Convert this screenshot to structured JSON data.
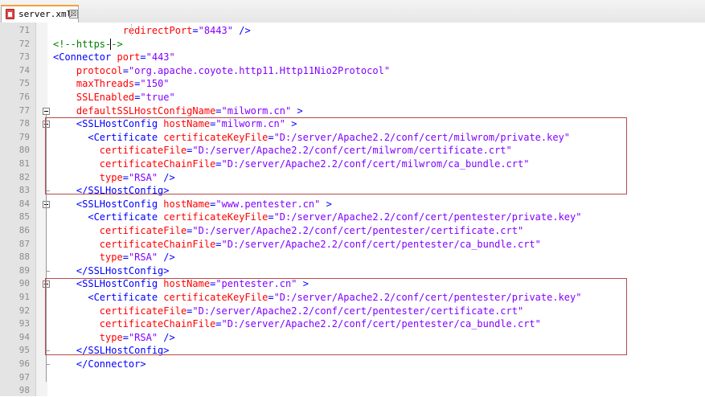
{
  "tab": {
    "filename": "server.xml",
    "close_glyph": "⊠"
  },
  "editor": {
    "lines": [
      {
        "n": "71",
        "indent": "",
        "tokens": [
          {
            "t": "ind",
            "v": "            "
          },
          {
            "t": "attr",
            "v": "redirectPort"
          },
          {
            "t": "tag",
            "v": "="
          },
          {
            "t": "val",
            "v": "\"8443\""
          },
          {
            "t": "tag",
            "v": " />"
          }
        ]
      },
      {
        "n": "72",
        "indent": "",
        "tokens": [
          {
            "t": "cmt",
            "v": "<!--https-->"
          }
        ]
      },
      {
        "n": "73",
        "indent": "",
        "tokens": [
          {
            "t": "tag",
            "v": "<Connector "
          },
          {
            "t": "attr",
            "v": "port"
          },
          {
            "t": "tag",
            "v": "="
          },
          {
            "t": "val",
            "v": "\"443\""
          }
        ]
      },
      {
        "n": "74",
        "indent": "",
        "tokens": [
          {
            "t": "ind",
            "v": "    "
          },
          {
            "t": "attr",
            "v": "protocol"
          },
          {
            "t": "tag",
            "v": "="
          },
          {
            "t": "val",
            "v": "\"org.apache.coyote.http11.Http11Nio2Protocol\""
          }
        ]
      },
      {
        "n": "75",
        "indent": "",
        "tokens": [
          {
            "t": "ind",
            "v": "    "
          },
          {
            "t": "attr",
            "v": "maxThreads"
          },
          {
            "t": "tag",
            "v": "="
          },
          {
            "t": "val",
            "v": "\"150\""
          }
        ]
      },
      {
        "n": "76",
        "indent": "",
        "tokens": [
          {
            "t": "ind",
            "v": "    "
          },
          {
            "t": "attr",
            "v": "SSLEnabled"
          },
          {
            "t": "tag",
            "v": "="
          },
          {
            "t": "val",
            "v": "\"true\""
          }
        ]
      },
      {
        "n": "77",
        "indent": "",
        "tokens": [
          {
            "t": "ind",
            "v": "    "
          },
          {
            "t": "attr",
            "v": "defaultSSLHostConfigName"
          },
          {
            "t": "tag",
            "v": "="
          },
          {
            "t": "val",
            "v": "\"milworm.cn\""
          },
          {
            "t": "tag",
            "v": " >"
          }
        ]
      },
      {
        "n": "78",
        "indent": "",
        "tokens": [
          {
            "t": "ind",
            "v": "    "
          },
          {
            "t": "tag",
            "v": "<SSLHostConfig "
          },
          {
            "t": "attr",
            "v": "hostName"
          },
          {
            "t": "tag",
            "v": "="
          },
          {
            "t": "val",
            "v": "\"milworm.cn\""
          },
          {
            "t": "tag",
            "v": " >"
          }
        ]
      },
      {
        "n": "79",
        "indent": "",
        "tokens": [
          {
            "t": "ind",
            "v": "      "
          },
          {
            "t": "tag",
            "v": "<Certificate "
          },
          {
            "t": "attr",
            "v": "certificateKeyFile"
          },
          {
            "t": "tag",
            "v": "="
          },
          {
            "t": "val",
            "v": "\"D:/server/Apache2.2/conf/cert/milwrom/private.key\""
          }
        ]
      },
      {
        "n": "80",
        "indent": "",
        "tokens": [
          {
            "t": "ind",
            "v": "        "
          },
          {
            "t": "attr",
            "v": "certificateFile"
          },
          {
            "t": "tag",
            "v": "="
          },
          {
            "t": "val",
            "v": "\"D:/server/Apache2.2/conf/cert/milwrom/certificate.crt\""
          }
        ]
      },
      {
        "n": "81",
        "indent": "",
        "tokens": [
          {
            "t": "ind",
            "v": "        "
          },
          {
            "t": "attr",
            "v": "certificateChainFile"
          },
          {
            "t": "tag",
            "v": "="
          },
          {
            "t": "val",
            "v": "\"D:/server/Apache2.2/conf/cert/milwrom/ca_bundle.crt\""
          }
        ]
      },
      {
        "n": "82",
        "indent": "",
        "tokens": [
          {
            "t": "ind",
            "v": "        "
          },
          {
            "t": "attr",
            "v": "type"
          },
          {
            "t": "tag",
            "v": "="
          },
          {
            "t": "val",
            "v": "\"RSA\""
          },
          {
            "t": "tag",
            "v": " />"
          }
        ]
      },
      {
        "n": "83",
        "indent": "",
        "tokens": [
          {
            "t": "ind",
            "v": "    "
          },
          {
            "t": "tag",
            "v": "</SSLHostConfig>"
          }
        ]
      },
      {
        "n": "84",
        "indent": "",
        "tokens": [
          {
            "t": "ind",
            "v": "    "
          },
          {
            "t": "tag",
            "v": "<SSLHostConfig "
          },
          {
            "t": "attr",
            "v": "hostName"
          },
          {
            "t": "tag",
            "v": "="
          },
          {
            "t": "val",
            "v": "\"www.pentester.cn\""
          },
          {
            "t": "tag",
            "v": " >"
          }
        ]
      },
      {
        "n": "85",
        "indent": "",
        "tokens": [
          {
            "t": "ind",
            "v": "      "
          },
          {
            "t": "tag",
            "v": "<Certificate "
          },
          {
            "t": "attr",
            "v": "certificateKeyFile"
          },
          {
            "t": "tag",
            "v": "="
          },
          {
            "t": "val",
            "v": "\"D:/server/Apache2.2/conf/cert/pentester/private.key\""
          }
        ]
      },
      {
        "n": "86",
        "indent": "",
        "tokens": [
          {
            "t": "ind",
            "v": "        "
          },
          {
            "t": "attr",
            "v": "certificateFile"
          },
          {
            "t": "tag",
            "v": "="
          },
          {
            "t": "val",
            "v": "\"D:/server/Apache2.2/conf/cert/pentester/certificate.crt\""
          }
        ]
      },
      {
        "n": "87",
        "indent": "",
        "tokens": [
          {
            "t": "ind",
            "v": "        "
          },
          {
            "t": "attr",
            "v": "certificateChainFile"
          },
          {
            "t": "tag",
            "v": "="
          },
          {
            "t": "val",
            "v": "\"D:/server/Apache2.2/conf/cert/pentester/ca_bundle.crt\""
          }
        ]
      },
      {
        "n": "88",
        "indent": "",
        "tokens": [
          {
            "t": "ind",
            "v": "        "
          },
          {
            "t": "attr",
            "v": "type"
          },
          {
            "t": "tag",
            "v": "="
          },
          {
            "t": "val",
            "v": "\"RSA\""
          },
          {
            "t": "tag",
            "v": " />"
          }
        ]
      },
      {
        "n": "89",
        "indent": "",
        "tokens": [
          {
            "t": "ind",
            "v": "    "
          },
          {
            "t": "tag",
            "v": "</SSLHostConfig>"
          }
        ]
      },
      {
        "n": "90",
        "indent": "",
        "tokens": [
          {
            "t": "ind",
            "v": "    "
          },
          {
            "t": "tag",
            "v": "<SSLHostConfig "
          },
          {
            "t": "attr",
            "v": "hostName"
          },
          {
            "t": "tag",
            "v": "="
          },
          {
            "t": "val",
            "v": "\"pentester.cn\""
          },
          {
            "t": "tag",
            "v": " >"
          }
        ]
      },
      {
        "n": "91",
        "indent": "",
        "tokens": [
          {
            "t": "ind",
            "v": "      "
          },
          {
            "t": "tag",
            "v": "<Certificate "
          },
          {
            "t": "attr",
            "v": "certificateKeyFile"
          },
          {
            "t": "tag",
            "v": "="
          },
          {
            "t": "val",
            "v": "\"D:/server/Apache2.2/conf/cert/pentester/private.key\""
          }
        ]
      },
      {
        "n": "92",
        "indent": "",
        "tokens": [
          {
            "t": "ind",
            "v": "        "
          },
          {
            "t": "attr",
            "v": "certificateFile"
          },
          {
            "t": "tag",
            "v": "="
          },
          {
            "t": "val",
            "v": "\"D:/server/Apache2.2/conf/cert/pentester/certificate.crt\""
          }
        ]
      },
      {
        "n": "93",
        "indent": "",
        "tokens": [
          {
            "t": "ind",
            "v": "        "
          },
          {
            "t": "attr",
            "v": "certificateChainFile"
          },
          {
            "t": "tag",
            "v": "="
          },
          {
            "t": "val",
            "v": "\"D:/server/Apache2.2/conf/cert/pentester/ca_bundle.crt\""
          }
        ]
      },
      {
        "n": "94",
        "indent": "",
        "tokens": [
          {
            "t": "ind",
            "v": "        "
          },
          {
            "t": "attr",
            "v": "type"
          },
          {
            "t": "tag",
            "v": "="
          },
          {
            "t": "val",
            "v": "\"RSA\""
          },
          {
            "t": "tag",
            "v": " />"
          }
        ]
      },
      {
        "n": "95",
        "indent": "",
        "tokens": [
          {
            "t": "ind",
            "v": "    "
          },
          {
            "t": "tag",
            "v": "</SSLHostConfig>"
          }
        ]
      },
      {
        "n": "96",
        "indent": "",
        "tokens": [
          {
            "t": "ind",
            "v": "    "
          },
          {
            "t": "tag",
            "v": "</Connector>"
          }
        ]
      },
      {
        "n": "97",
        "indent": "",
        "tokens": []
      },
      {
        "n": "98",
        "indent": "",
        "tokens": []
      }
    ]
  },
  "colors": {
    "tag": "#0000ff",
    "attribute": "#ff0000",
    "value": "#8000ff",
    "comment": "#008000",
    "highlight_border": "#b84a4a",
    "gutter": "#e4e4e4",
    "tab_accent": "#f2a23a"
  },
  "icons": {
    "file": "xml-file-icon",
    "close": "close-icon",
    "fold": "fold-toggle-icon"
  }
}
